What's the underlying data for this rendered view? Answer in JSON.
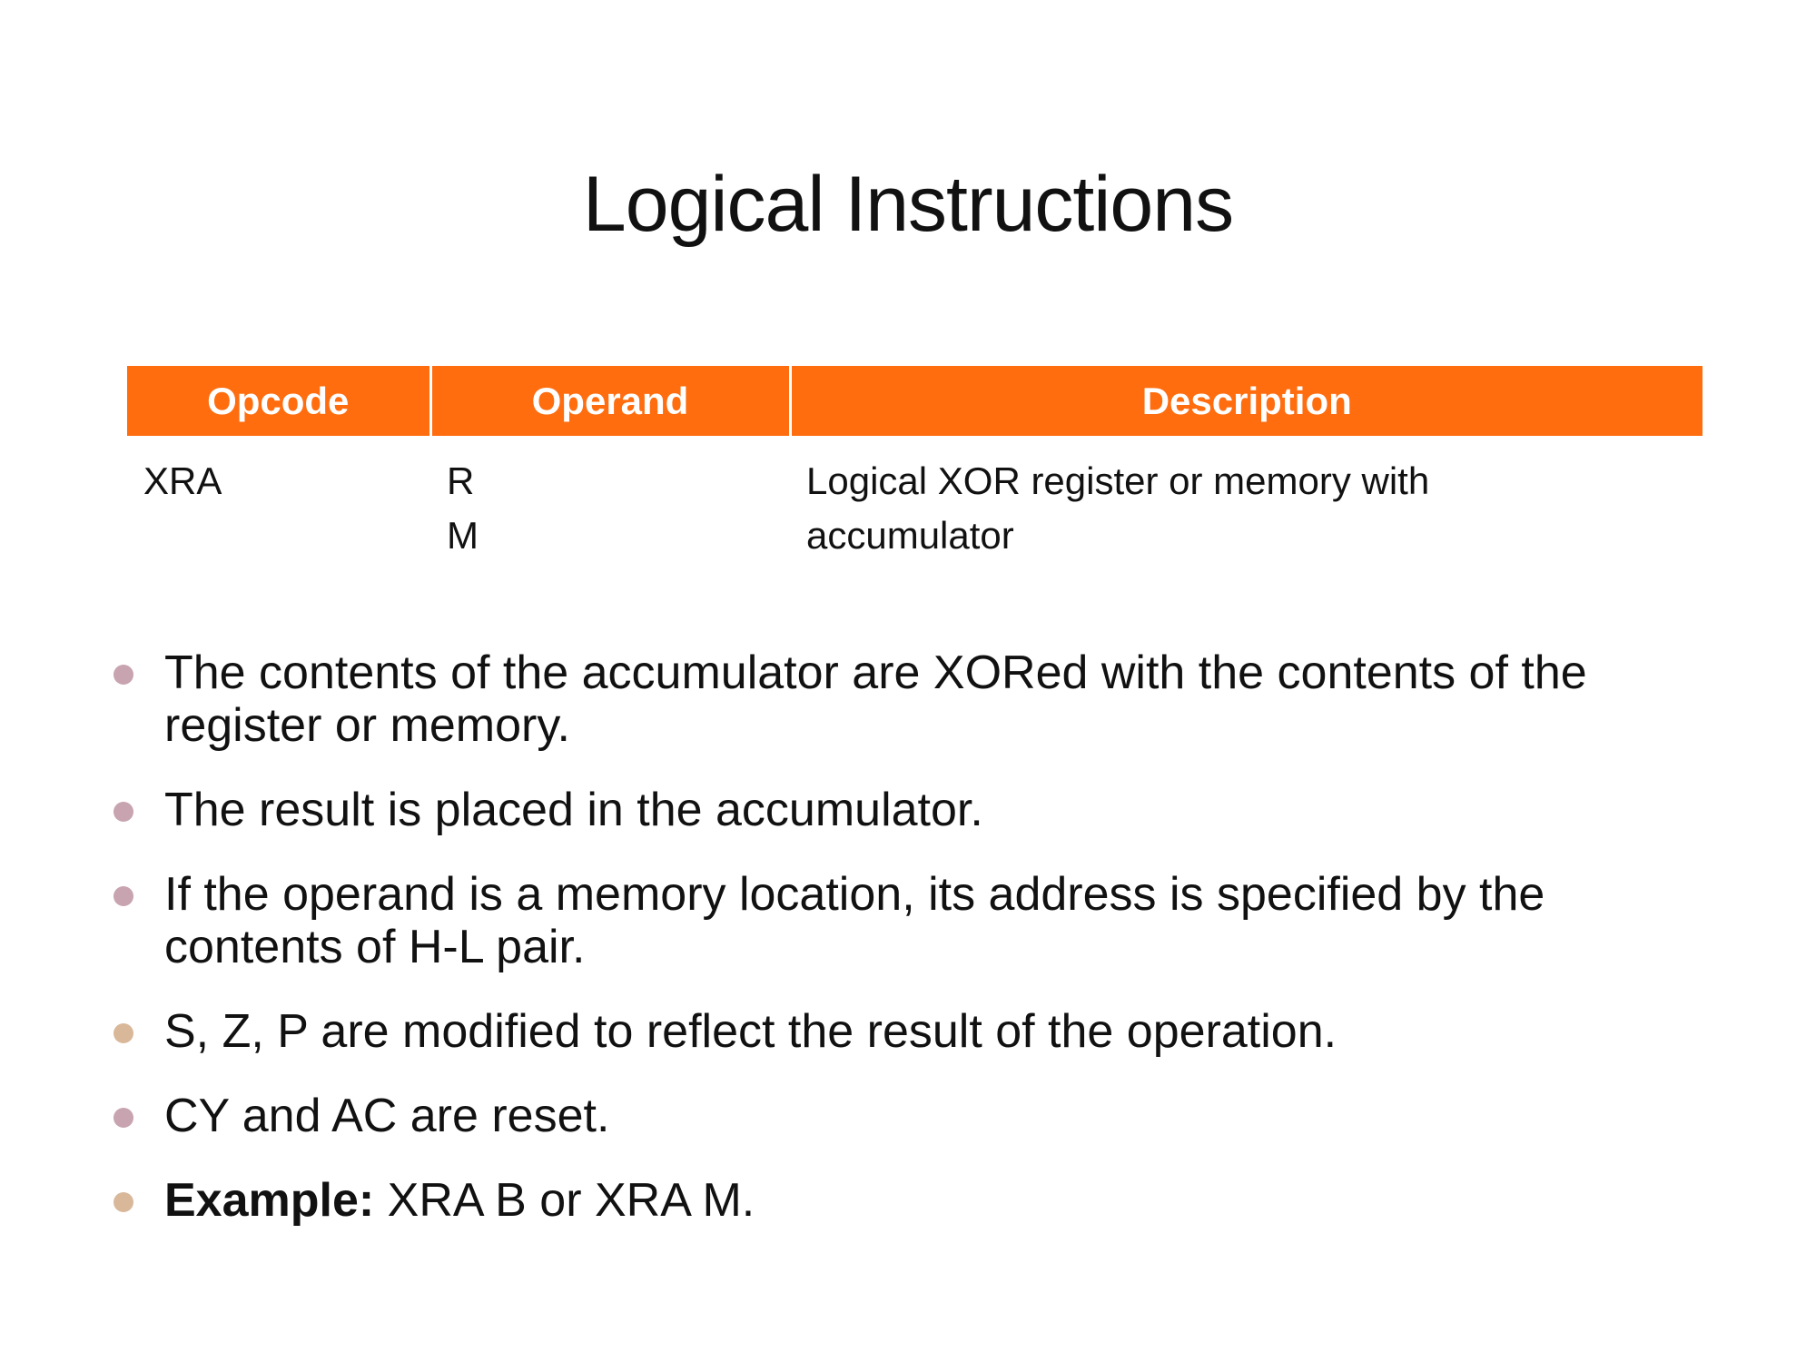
{
  "slide": {
    "title": "Logical Instructions",
    "table": {
      "headers": [
        "Opcode",
        "Operand",
        "Description"
      ],
      "row": {
        "opcode": "XRA",
        "operands": [
          "R",
          "M"
        ],
        "description_lines": [
          "Logical XOR register or memory with",
          "accumulator"
        ]
      }
    },
    "bullets": [
      {
        "lines": [
          "The contents of the accumulator are XORed with the contents of the",
          "register or memory."
        ]
      },
      {
        "lines": [
          "The result is placed in the accumulator."
        ]
      },
      {
        "lines": [
          "If the operand is a memory location, its address is specified by the",
          "contents of H-L pair."
        ]
      },
      {
        "lines": [
          "S, Z, P are modified to reflect the result of the operation."
        ]
      },
      {
        "lines": [
          "CY and AC are reset."
        ]
      },
      {
        "label": "Example:",
        "text": " XRA B or XRA M."
      }
    ],
    "colors": {
      "header_bg": "#ff6d0f",
      "header_text": "#ffffff",
      "bullet_dot": "#d2b0ab"
    }
  }
}
